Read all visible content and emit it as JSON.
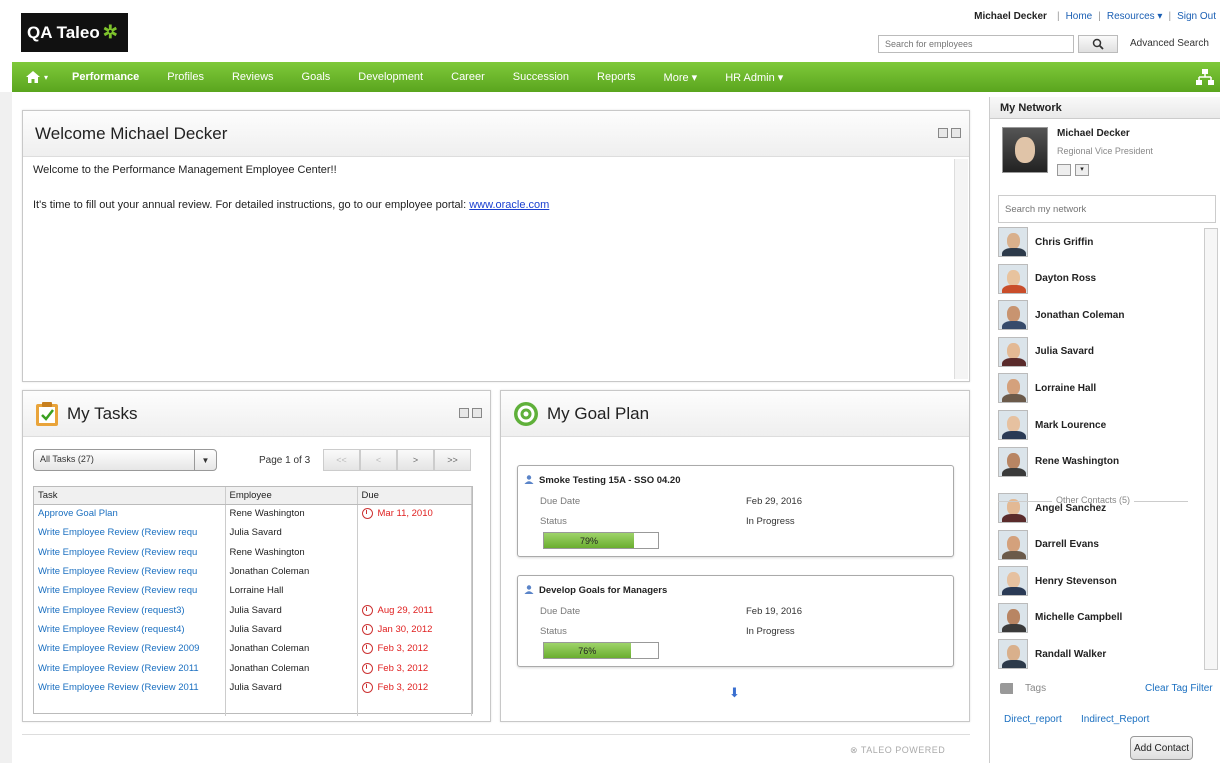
{
  "brand": {
    "logo_text": "QA Taleo",
    "logo_mark": "✲"
  },
  "user_links": {
    "name": "Michael Decker",
    "home": "Home",
    "resources": "Resources ▾",
    "signout": "Sign Out"
  },
  "search": {
    "placeholder": "Search for employees",
    "advanced": "Advanced Search"
  },
  "nav": {
    "home_caret": "▾",
    "items": [
      "Performance",
      "Profiles",
      "Reviews",
      "Goals",
      "Development",
      "Career",
      "Succession",
      "Reports",
      "More ▾",
      "HR Admin ▾"
    ]
  },
  "welcome": {
    "title": "Welcome Michael Decker",
    "line1": "Welcome to the Performance Management Employee Center!!",
    "line2": "It's time to fill out your annual review. For detailed instructions, go to our employee portal: ",
    "link": "www.oracle.com"
  },
  "tasks": {
    "title": "My Tasks",
    "filter": "All Tasks (27)",
    "page_info": "Page 1 of 3",
    "pager": [
      "<<",
      "<",
      ">",
      ">>"
    ],
    "columns": [
      "Task",
      "Employee",
      "Due"
    ],
    "rows": [
      {
        "task": "Approve Goal Plan",
        "employee": "Rene Washington",
        "due": "Mar 11, 2010",
        "clock": true
      },
      {
        "task": "Write Employee Review (Review requ",
        "employee": "Julia Savard",
        "due": "",
        "clock": false
      },
      {
        "task": "Write Employee Review (Review requ",
        "employee": "Rene Washington",
        "due": "",
        "clock": false
      },
      {
        "task": "Write Employee Review (Review requ",
        "employee": "Jonathan Coleman",
        "due": "",
        "clock": false
      },
      {
        "task": "Write Employee Review (Review requ",
        "employee": "Lorraine Hall",
        "due": "",
        "clock": false
      },
      {
        "task": "Write Employee Review (request3)",
        "employee": "Julia Savard",
        "due": "Aug 29, 2011",
        "clock": true
      },
      {
        "task": "Write Employee Review (request4)",
        "employee": "Julia Savard",
        "due": "Jan 30, 2012",
        "clock": true
      },
      {
        "task": "Write Employee Review (Review 2009",
        "employee": "Jonathan Coleman",
        "due": "Feb 3, 2012",
        "clock": true
      },
      {
        "task": "Write Employee Review (Review 2011",
        "employee": "Jonathan Coleman",
        "due": "Feb 3, 2012",
        "clock": true
      },
      {
        "task": "Write Employee Review (Review 2011",
        "employee": "Julia Savard",
        "due": "Feb 3, 2012",
        "clock": true
      }
    ]
  },
  "goals": {
    "title": "My Goal Plan",
    "cards": [
      {
        "name": "Smoke Testing 15A - SSO 04.20",
        "due_label": "Due Date",
        "due": "Feb 29, 2016",
        "status_label": "Status",
        "status": "In Progress",
        "progress": 79,
        "progress_text": "79%"
      },
      {
        "name": "Develop Goals for Managers",
        "due_label": "Due Date",
        "due": "Feb 19, 2016",
        "status_label": "Status",
        "status": "In Progress",
        "progress": 76,
        "progress_text": "76%"
      }
    ]
  },
  "footer": {
    "powered": "TALEO POWERED"
  },
  "network": {
    "title": "My Network",
    "me": {
      "name": "Michael Decker",
      "title": "Regional Vice President"
    },
    "search_placeholder": "Search my network",
    "contacts": [
      "Chris Griffin",
      "Dayton Ross",
      "Jonathan Coleman",
      "Julia Savard",
      "Lorraine Hall",
      "Mark Lourence",
      "Rene Washington"
    ],
    "other_label": "Other Contacts (5)",
    "others": [
      "Angel Sanchez",
      "Darrell Evans",
      "Henry Stevenson",
      "Michelle Campbell",
      "Randall Walker"
    ],
    "tags_label": "Tags",
    "clear_filter": "Clear Tag Filter",
    "direct": "Direct_report",
    "indirect": "Indirect_Report",
    "add_contact": "Add Contact"
  },
  "colors": {
    "nav_green": "#6bb82a",
    "link_blue": "#1a6fc0",
    "due_red": "#e02020",
    "progress_green": "#7fc23f"
  }
}
